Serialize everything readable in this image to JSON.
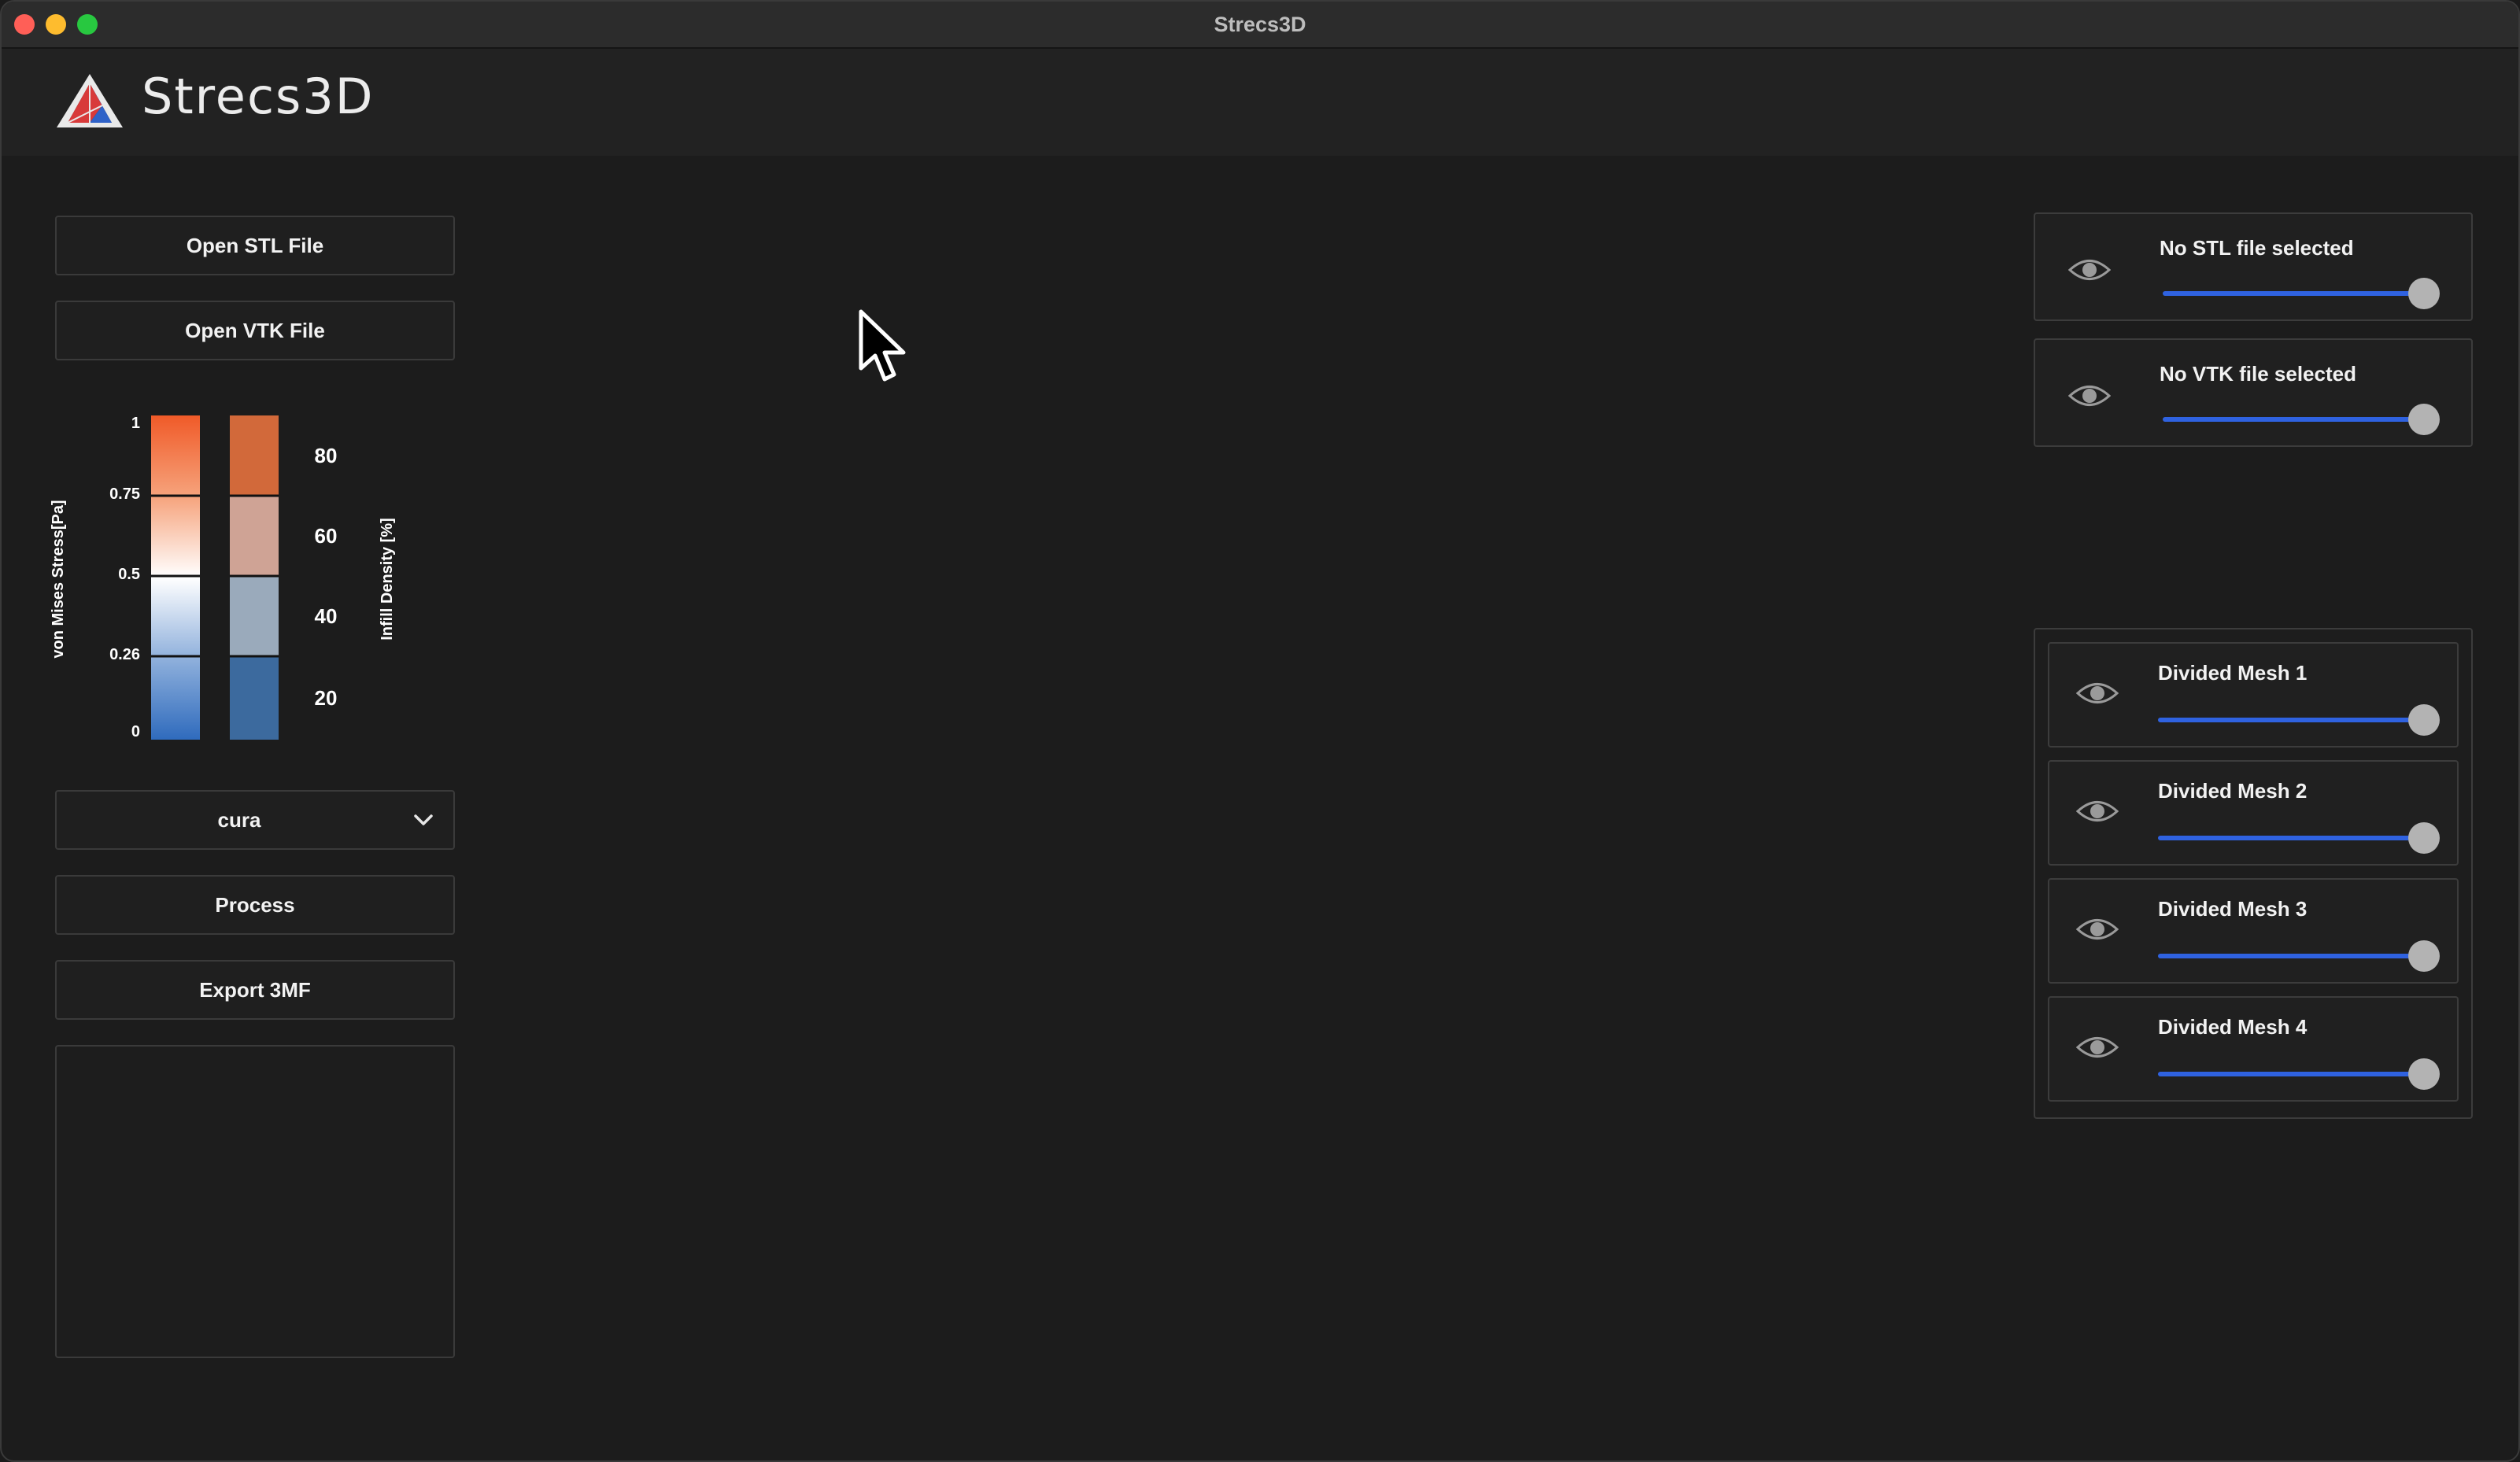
{
  "window": {
    "title": "Strecs3D"
  },
  "app": {
    "name": "Strecs3D"
  },
  "left_panel": {
    "open_stl_label": "Open STL File",
    "open_vtk_label": "Open VTK File",
    "dropdown_value": "cura",
    "process_label": "Process",
    "export_label": "Export 3MF"
  },
  "legend": {
    "stress_axis_label": "von Mises Stress[Pa]",
    "stress_ticks": [
      "1",
      "0.75",
      "0.5",
      "0.26",
      "0"
    ],
    "density_axis_label": "Infill Density [%]",
    "density_ticks": [
      "80",
      "60",
      "40",
      "20"
    ],
    "colors": {
      "stress_high": "#f05a28",
      "stress_mid": "#ffffff",
      "stress_low": "#2f6bbd",
      "density_80": "#d2693a",
      "density_60": "#cfa395",
      "density_40": "#9aaabb",
      "density_20": "#3c6a9e"
    }
  },
  "file_panels": [
    {
      "label": "No STL file selected",
      "icon": "eye-icon",
      "opacity": 1.0
    },
    {
      "label": "No VTK file selected",
      "icon": "eye-icon",
      "opacity": 1.0
    }
  ],
  "mesh_panels": [
    {
      "label": "Divided Mesh 1",
      "icon": "eye-icon",
      "opacity": 1.0
    },
    {
      "label": "Divided Mesh 2",
      "icon": "eye-icon",
      "opacity": 1.0
    },
    {
      "label": "Divided Mesh 3",
      "icon": "eye-icon",
      "opacity": 1.0
    },
    {
      "label": "Divided Mesh 4",
      "icon": "eye-icon",
      "opacity": 1.0
    }
  ],
  "theme": {
    "accent": "#2f62e0",
    "background": "#1c1c1c"
  }
}
